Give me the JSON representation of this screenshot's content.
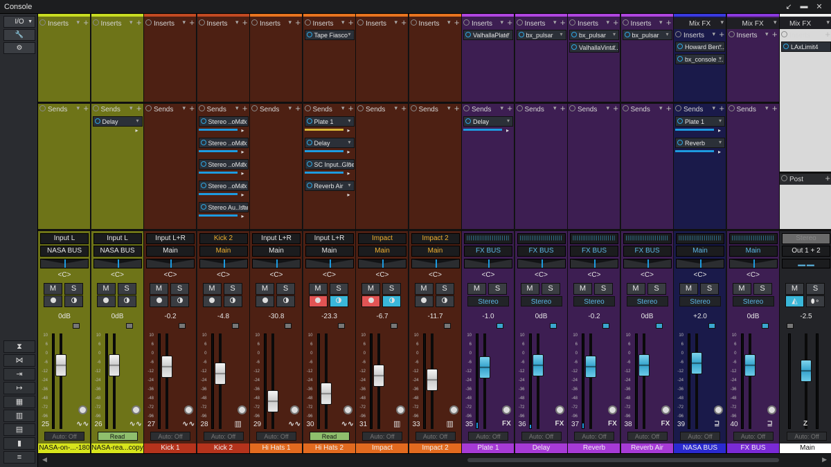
{
  "window": {
    "title": "Console",
    "btn_min": "↙",
    "btn_max": "▬",
    "btn_close": "✕"
  },
  "left_panel": {
    "io_label": "I/O",
    "io_arrow": "▼",
    "wrench": "🔧",
    "plug": "⚙",
    "nav_icons": [
      "⧗",
      "⋈",
      "⇥",
      "↦",
      "▦",
      "▥",
      "▤",
      "▮",
      "≡"
    ]
  },
  "section_labels": {
    "inserts": "Inserts",
    "sends": "Sends",
    "post": "Post",
    "mixfx": "Mix FX",
    "add": "+",
    "arrow": "▾",
    "center": "<C>",
    "mute": "M",
    "solo": "S"
  },
  "scale": [
    "10",
    "6",
    "0",
    "-6",
    "-12",
    "-24",
    "-36",
    "-48",
    "-72",
    "-96"
  ],
  "master_name": "Main",
  "channels": [
    {
      "num": "25",
      "name": "NASA-on-...-180",
      "color": "#6e7418",
      "name_bg": "#d7e41c",
      "name_fg": "#111",
      "top": "#c8dc22",
      "input": "Input L",
      "output": "NASA BUS",
      "out_color": "#e6e6e6",
      "volume": "0dB",
      "fader_level": 0.72,
      "meter_level": 0.0,
      "auto": "Auto: Off",
      "auto_read": false,
      "type": "wave",
      "inserts": [],
      "sends": [],
      "fader_style": "w",
      "rec": false,
      "mode": "ms"
    },
    {
      "num": "26",
      "name": "NASA-rea...copy",
      "color": "#6e7418",
      "name_bg": "#d7e41c",
      "name_fg": "#111",
      "top": "#c8dc22",
      "input": "Input L",
      "output": "NASA BUS",
      "out_color": "#e6e6e6",
      "volume": "0dB",
      "fader_level": 0.72,
      "meter_level": 0.0,
      "auto": "Read",
      "auto_read": true,
      "type": "wave",
      "inserts": [],
      "sends": [
        {
          "label": "Delay",
          "bar": "none"
        }
      ],
      "fader_style": "w",
      "rec": false,
      "mode": "ms"
    },
    {
      "num": "27",
      "name": "Kick 1",
      "color": "#4d2013",
      "name_bg": "#b5331c",
      "name_fg": "#f0f0f0",
      "top": "#c24a22",
      "input": "Input L+R",
      "output": "Main",
      "out_color": "#e6e6e6",
      "volume": "-0.2",
      "fader_level": 0.71,
      "meter_level": 0.0,
      "auto": "Auto: Off",
      "auto_read": false,
      "type": "wave",
      "inserts": [],
      "sends": [],
      "fader_style": "w",
      "rec": false,
      "mode": "ms"
    },
    {
      "num": "28",
      "name": "Kick 2",
      "color": "#4d2013",
      "name_bg": "#b5331c",
      "name_fg": "#f0f0f0",
      "top": "#c24a22",
      "input": "Kick 2",
      "output": "Main",
      "out_color": "#f0b030",
      "input_color": "#f0b030",
      "volume": "-4.8",
      "fader_level": 0.63,
      "meter_level": 0.0,
      "auto": "Auto: Off",
      "auto_read": false,
      "type": "piano",
      "inserts": [],
      "sends": [
        {
          "label": "Stereo ..oMax",
          "bar": "b"
        },
        {
          "label": "Stereo ..oMax",
          "bar": "b"
        },
        {
          "label": "Stereo ..oMax",
          "bar": "b"
        },
        {
          "label": "Stereo ..oMax",
          "bar": "b"
        },
        {
          "label": "Stereo Au..lsar",
          "bar": "b"
        }
      ],
      "fader_style": "w",
      "rec": false,
      "mode": "ms"
    },
    {
      "num": "29",
      "name": "Hi Hats 1",
      "color": "#4d2013",
      "name_bg": "#e26a1f",
      "name_fg": "#f0f0f0",
      "top": "#e8741f",
      "input": "Input L+R",
      "output": "Main",
      "out_color": "#e6e6e6",
      "volume": "-30.8",
      "fader_level": 0.32,
      "meter_level": 0.0,
      "auto": "Auto: Off",
      "auto_read": false,
      "type": "wave",
      "inserts": [],
      "sends": [],
      "fader_style": "w",
      "rec": false,
      "mode": "ms"
    },
    {
      "num": "30",
      "name": "Hi Hats 2",
      "color": "#4d2013",
      "name_bg": "#e26a1f",
      "name_fg": "#f0f0f0",
      "top": "#e8741f",
      "input": "Input L+R",
      "output": "Main",
      "out_color": "#e6e6e6",
      "volume": "-23.3",
      "fader_level": 0.41,
      "meter_level": 0.0,
      "auto": "Read",
      "auto_read": true,
      "type": "wave",
      "inserts": [
        {
          "label": "Tape Fiasco"
        }
      ],
      "sends": [
        {
          "label": "Plate 1",
          "bar": "y"
        },
        {
          "label": "Delay",
          "bar": "b"
        },
        {
          "label": "SC Input..Glue",
          "bar": "b"
        },
        {
          "label": "Reverb Air",
          "bar": "none"
        }
      ],
      "fader_style": "w",
      "rec": true,
      "mode": "ms"
    },
    {
      "num": "31",
      "name": "Impact",
      "color": "#4d2013",
      "name_bg": "#e26a1f",
      "name_fg": "#f0f0f0",
      "top": "#e8741f",
      "input": "Impact",
      "output": "Main",
      "out_color": "#f0b030",
      "input_color": "#f0b030",
      "volume": "-6.7",
      "fader_level": 0.61,
      "meter_level": 0.0,
      "auto": "Auto: Off",
      "auto_read": false,
      "type": "piano",
      "inserts": [],
      "sends": [],
      "fader_style": "w",
      "rec": true,
      "mode": "ms"
    },
    {
      "num": "33",
      "name": "Impact 2",
      "color": "#4d2013",
      "name_bg": "#e26a1f",
      "name_fg": "#f0f0f0",
      "top": "#e8741f",
      "input": "Impact 2",
      "output": "Main",
      "out_color": "#f0b030",
      "input_color": "#f0b030",
      "volume": "-11.7",
      "fader_level": 0.56,
      "meter_level": 0.0,
      "auto": "Auto: Off",
      "auto_read": false,
      "type": "piano",
      "inserts": [],
      "sends": [],
      "fader_style": "w",
      "rec": false,
      "mode": "ms"
    },
    {
      "num": "35",
      "name": "Plate 1",
      "color": "#3d1e52",
      "name_bg": "#a63ad6",
      "name_fg": "#f0f0f0",
      "top": "#b046e0",
      "input": "",
      "output": "FX BUS",
      "out_color": "#5cb8e6",
      "volume": "-1.0",
      "fader_level": 0.7,
      "meter_level": 0.06,
      "auto": "Auto: Off",
      "auto_read": false,
      "type": "fx",
      "type_text": "FX",
      "inserts": [
        {
          "label": "ValhallaPlate"
        }
      ],
      "sends": [
        {
          "label": "Delay",
          "bar": "b"
        }
      ],
      "fader_style": "b",
      "rec": false,
      "mode": "fx"
    },
    {
      "num": "36",
      "name": "Delay",
      "color": "#3d1e52",
      "name_bg": "#a63ad6",
      "name_fg": "#f0f0f0",
      "top": "#b046e0",
      "input": "",
      "output": "FX BUS",
      "out_color": "#5cb8e6",
      "volume": "0dB",
      "fader_level": 0.72,
      "meter_level": 0.04,
      "auto": "Auto: Off",
      "auto_read": false,
      "type": "fx",
      "type_text": "FX",
      "inserts": [
        {
          "label": "bx_pulsar"
        }
      ],
      "sends": [],
      "fader_style": "b",
      "rec": false,
      "mode": "fx"
    },
    {
      "num": "37",
      "name": "Reverb",
      "color": "#3d1e52",
      "name_bg": "#a63ad6",
      "name_fg": "#f0f0f0",
      "top": "#b046e0",
      "input": "",
      "output": "FX BUS",
      "out_color": "#5cb8e6",
      "volume": "-0.2",
      "fader_level": 0.71,
      "meter_level": 0.05,
      "auto": "Auto: Off",
      "auto_read": false,
      "type": "fx",
      "type_text": "FX",
      "inserts": [
        {
          "label": "bx_pulsar"
        },
        {
          "label": "ValhallaVinta..."
        }
      ],
      "sends": [],
      "fader_style": "b",
      "rec": false,
      "mode": "fx"
    },
    {
      "num": "38",
      "name": "Reverb Air",
      "color": "#3d1e52",
      "name_bg": "#a63ad6",
      "name_fg": "#f0f0f0",
      "top": "#b046e0",
      "input": "",
      "output": "FX BUS",
      "out_color": "#5cb8e6",
      "volume": "0dB",
      "fader_level": 0.72,
      "meter_level": 0.0,
      "auto": "Auto: Off",
      "auto_read": false,
      "type": "fx",
      "type_text": "FX",
      "inserts": [
        {
          "label": "bx_pulsar"
        }
      ],
      "sends": [],
      "fader_style": "b",
      "rec": false,
      "mode": "fx"
    },
    {
      "num": "39",
      "name": "NASA BUS",
      "color": "#1a1a4a",
      "name_bg": "#2a2ad0",
      "name_fg": "#f0f0f0",
      "top": "#3a3ae0",
      "input": "",
      "output": "Main",
      "out_color": "#5cb8e6",
      "volume": "+2.0",
      "fader_level": 0.75,
      "meter_level": 0.0,
      "auto": "Auto: Off",
      "auto_read": false,
      "type": "bus",
      "type_text": "⊒",
      "mixfx": true,
      "inserts": [
        {
          "label": "Howard Ben..."
        },
        {
          "label": "bx_console ..."
        }
      ],
      "sends": [
        {
          "label": "Plate 1",
          "bar": "b"
        },
        {
          "label": "Reverb",
          "bar": "b"
        }
      ],
      "fader_style": "b",
      "rec": false,
      "mode": "fx"
    },
    {
      "num": "40",
      "name": "FX BUS",
      "color": "#3d1e52",
      "name_bg": "#7a2ad6",
      "name_fg": "#f0f0f0",
      "top": "#8a3ae0",
      "input": "",
      "output": "Main",
      "out_color": "#5cb8e6",
      "volume": "0dB",
      "fader_level": 0.72,
      "meter_level": 0.0,
      "auto": "Auto: Off",
      "auto_read": false,
      "type": "bus",
      "type_text": "⊒",
      "mixfx": true,
      "inserts": [],
      "sends": [],
      "fader_style": "b",
      "rec": false,
      "mode": "fx"
    }
  ],
  "master": {
    "mixfx_label": "Mix FX",
    "insert": "LAxLimit4",
    "post_label": "Post",
    "stereo_label": "Stereo",
    "output": "Out 1 + 2",
    "volume": "-2.5",
    "fader_level": 0.66,
    "auto": "Auto: Off",
    "name": "Main",
    "type_text": "Z"
  }
}
